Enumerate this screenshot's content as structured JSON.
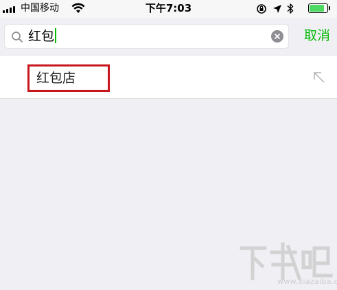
{
  "status_bar": {
    "carrier": "中国移动",
    "time": "下午7:03",
    "battery_level": 0.85,
    "battery_color": "#4cd964"
  },
  "search": {
    "query": "红包",
    "icon": "search-icon",
    "clear_icon": "clear-icon",
    "cancel_label": "取消",
    "accent_color": "#09bb07"
  },
  "suggestions": [
    {
      "label": "红包店",
      "icon": "fill-arrow-icon"
    }
  ],
  "highlight_color": "#c8161d",
  "watermark": {
    "logo": "下载吧",
    "text": "www.xiazaiba.com"
  }
}
